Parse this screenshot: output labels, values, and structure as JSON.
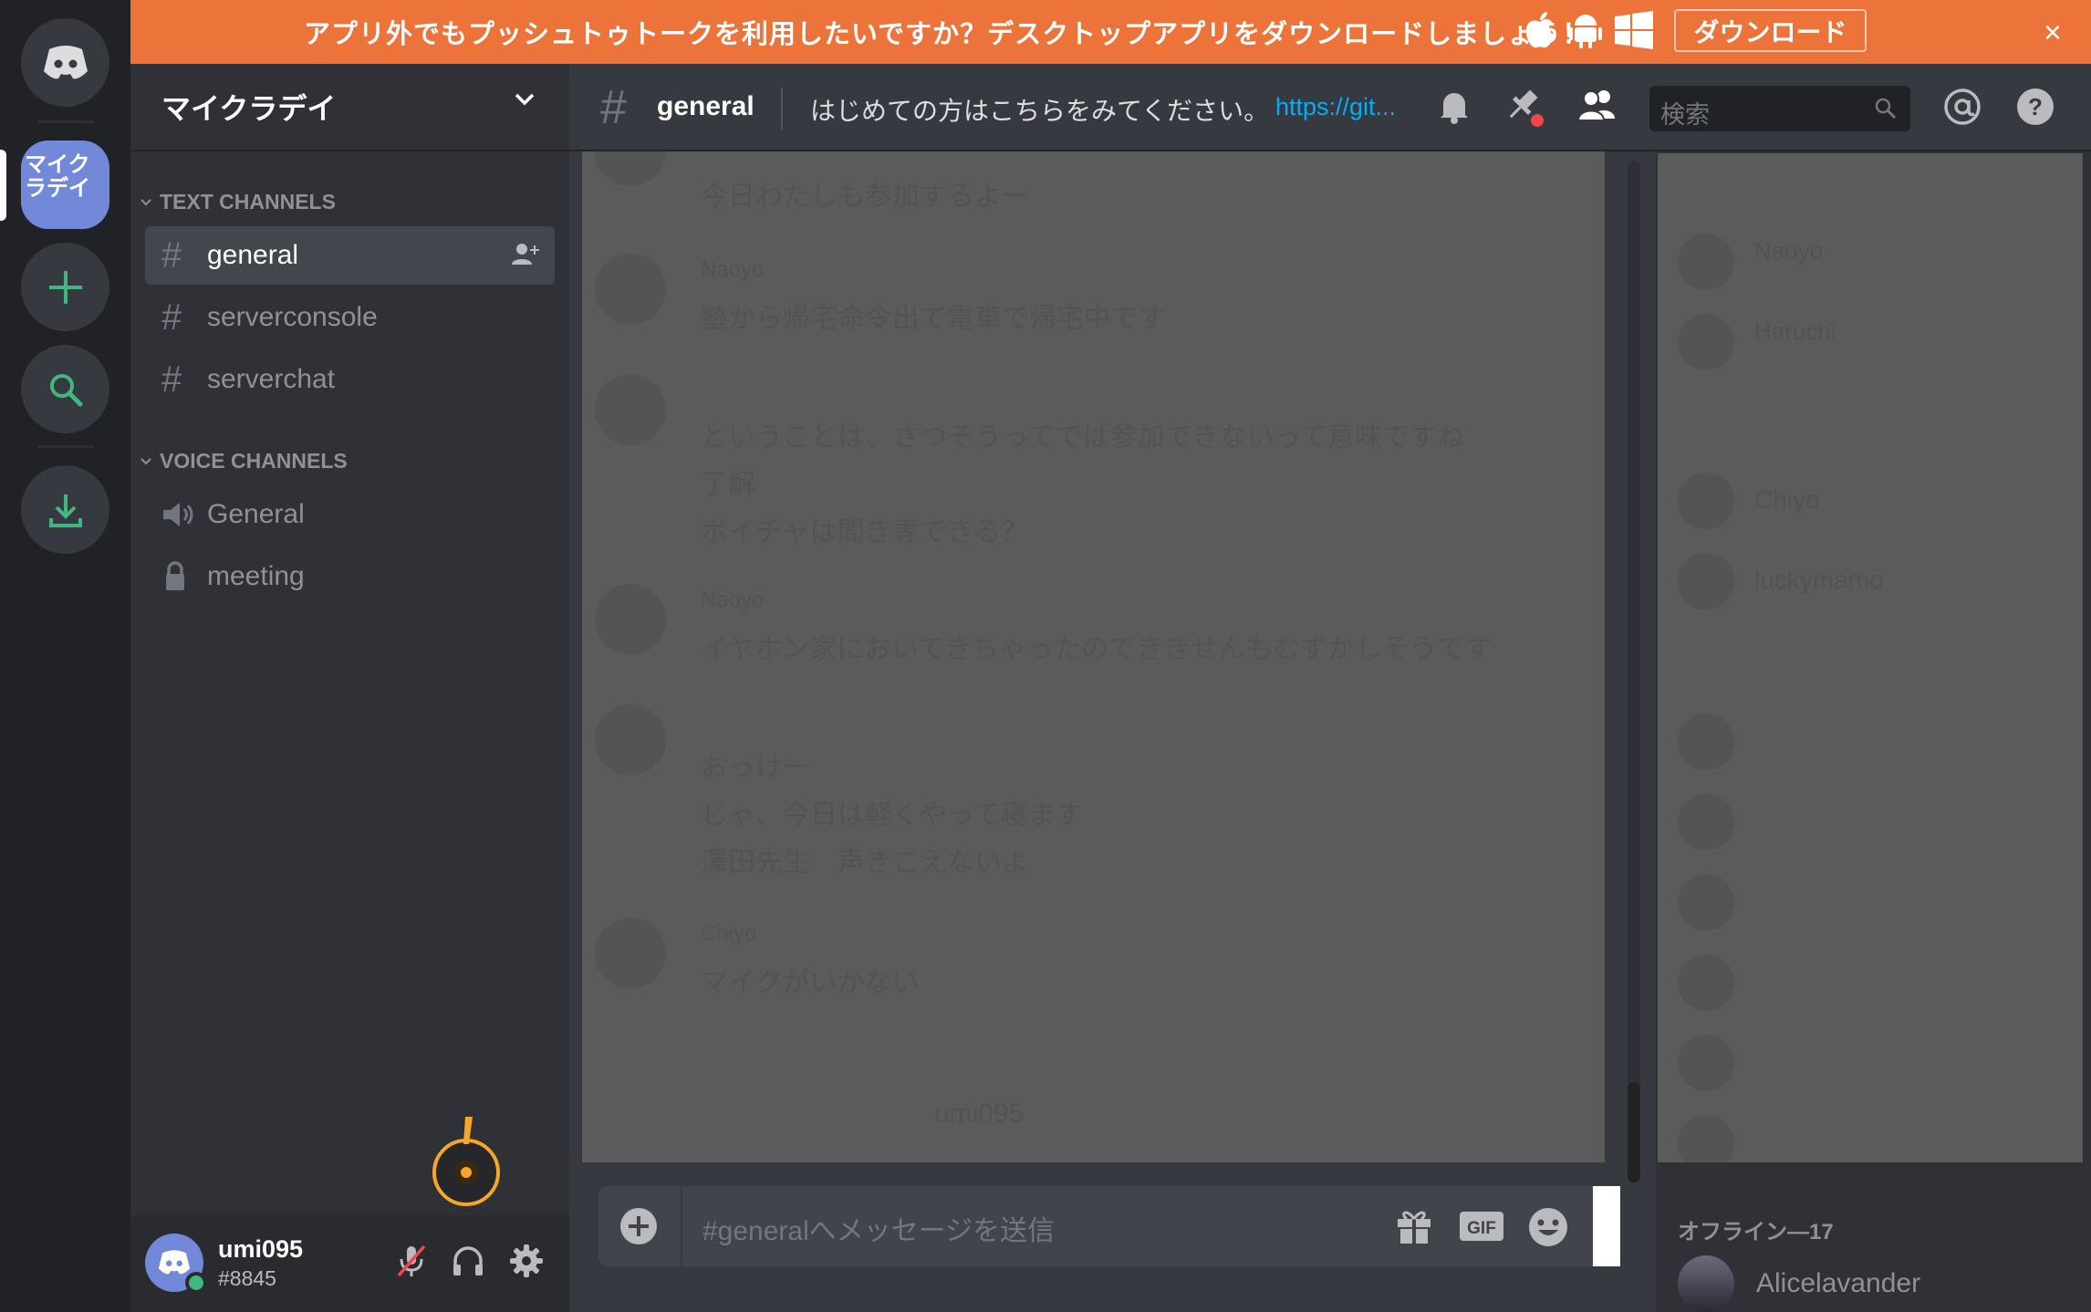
{
  "banner": {
    "text": "アプリ外でもプッシュトゥトークを利用したいですか？デスクトップアプリをダウンロードしましょう！",
    "download_label": "ダウンロード",
    "close_label": "×"
  },
  "guilds": {
    "server_label": "マイクラデイ"
  },
  "sidebar": {
    "server_name": "マイクラデイ",
    "text_category": "TEXT CHANNELS",
    "voice_category": "VOICE CHANNELS",
    "text_channels": [
      {
        "label": "general",
        "active": true
      },
      {
        "label": "serverconsole",
        "active": false
      },
      {
        "label": "serverchat",
        "active": false
      }
    ],
    "voice_channels": [
      {
        "label": "General",
        "icon": "speaker-icon"
      },
      {
        "label": "meeting",
        "icon": "lock-icon"
      }
    ]
  },
  "user": {
    "name": "umi095",
    "tag": "#8845"
  },
  "chat_header": {
    "channel": "general",
    "topic": "はじめての方はこちらをみてください。",
    "link": "https://git...",
    "search_placeholder": "検索"
  },
  "composer": {
    "placeholder": "#generalへメッセージを送信"
  },
  "messages_faded": [
    "今日わたしも参加するよー",
    "Naoyo",
    "塾から帰宅命令出て電車で帰宅中です",
    "ということは、さつそうってでは参加できないって意味ですね",
    "了解",
    "ボイチャは聞き専できる？",
    "Naoyo",
    "イヤホン家においてきちゃったのでききせんもむずかしそうです",
    "おっけー",
    "じゃ、今日は軽くやって寝ます",
    "澤田先生　声きこえないよ",
    "Chiyo",
    "マイクがいかない",
    "umi095"
  ],
  "members": {
    "offline_header": "オフライン—17",
    "first_offline": "Alicelavander",
    "faded_names": [
      "Naoyo",
      "Haruchi",
      "Chiyo",
      "luckymamo"
    ]
  },
  "colors": {
    "banner": "#ec7339",
    "blurple": "#7289da",
    "online": "#43b581",
    "link": "#00b0f4",
    "beacon": "#f7a728"
  }
}
